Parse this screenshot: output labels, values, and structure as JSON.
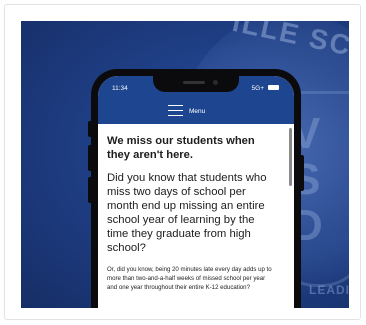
{
  "seal": {
    "top_text": "ILLE SCHO",
    "letters": "VSD",
    "bottom_text": "LEADIN"
  },
  "phone": {
    "status_time": "11:34",
    "status_signal": "5G+",
    "menu_label": "Menu"
  },
  "article": {
    "heading": "We miss our students when they aren't here.",
    "lead": "Did you know that students who miss two days of school per month end up missing an entire school year of learning by the time they graduate from high school?",
    "body": "Or, did you know, being 20 minutes late every day adds up to more than two-and-a-half weeks of missed school per year and one year throughout their entire K-12 education?"
  },
  "colors": {
    "brand_blue": "#1e4690",
    "background_blue": "#1f3f86"
  }
}
